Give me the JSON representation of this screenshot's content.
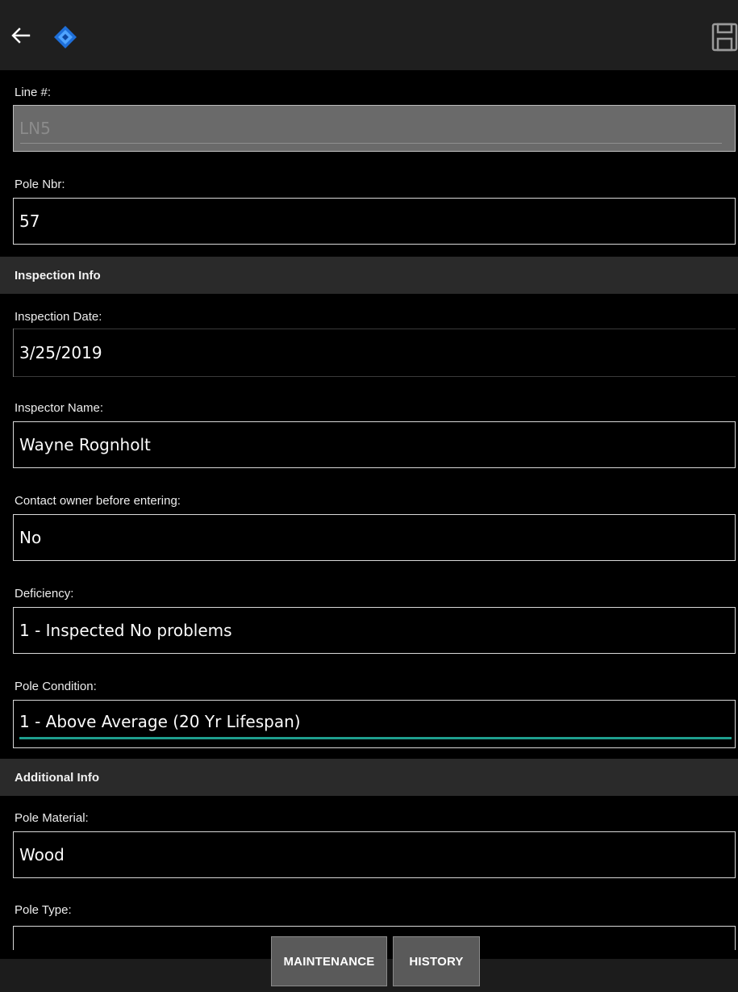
{
  "appbar": {
    "back_icon": "arrow-left-icon",
    "logo_icon": "app-logo-icon",
    "save_icon": "floppy-save-icon",
    "logo_color": "#1e88e5"
  },
  "fields": {
    "line": {
      "label": "Line #:",
      "value": "LN5"
    },
    "pole_nbr": {
      "label": "Pole Nbr:",
      "value": "57"
    },
    "inspection_date": {
      "label": "Inspection Date:",
      "value": "3/25/2019"
    },
    "inspector_name": {
      "label": "Inspector Name:",
      "value": "Wayne Rognholt"
    },
    "contact_owner": {
      "label": "Contact owner before entering:",
      "value": "No"
    },
    "deficiency": {
      "label": "Deficiency:",
      "value": "1 - Inspected No problems"
    },
    "pole_condition": {
      "label": "Pole Condition:",
      "value": "1 - Above Average (20 Yr Lifespan)"
    },
    "pole_material": {
      "label": "Pole Material:",
      "value": "Wood"
    },
    "pole_type": {
      "label": "Pole Type:",
      "value": ""
    }
  },
  "sections": {
    "inspection": "Inspection Info",
    "additional": "Additional Info"
  },
  "buttons": {
    "maintenance": "MAINTENANCE",
    "history": "HISTORY"
  },
  "colors": {
    "focus_underline": "#1e9e8e",
    "section_bg": "#2a2a2a",
    "disabled_bg": "#6a6a6a"
  }
}
